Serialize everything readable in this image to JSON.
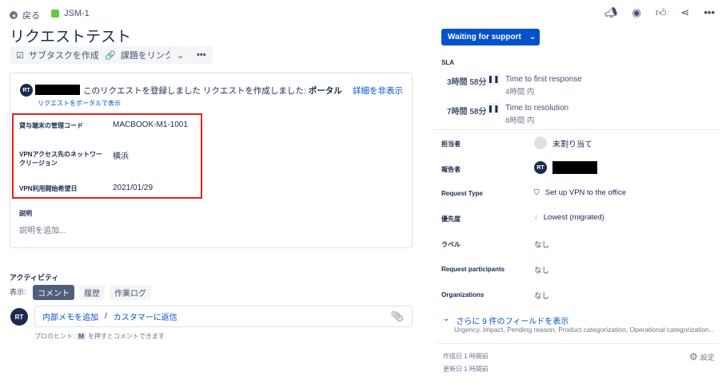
{
  "header": {
    "back": "戻る",
    "issue_key": "JSM-1",
    "title": "リクエストテスト"
  },
  "toolbar": {
    "subtask": "サブタスクを作成",
    "link_issue": "課題をリンク"
  },
  "request": {
    "avatar": "RT",
    "message": "このリクエストを登録しました リクエストを作成しました:",
    "channel": "ポータル",
    "hide_details": "詳細を非表示",
    "view_portal": "リクエストをポータルで表示"
  },
  "fields": [
    {
      "label": "貸与端末の管理コード",
      "value": "MACBOOK-M1-1001"
    },
    {
      "label": "VPNアクセス先のネットワークリージョン",
      "value": "横浜"
    },
    {
      "label": "VPN利用開始希望日",
      "value": "2021/01/29"
    }
  ],
  "description": {
    "label": "説明",
    "placeholder": "説明を追加..."
  },
  "activity": {
    "title": "アクティビティ",
    "show": "表示:",
    "tabs": [
      "コメント",
      "履歴",
      "作業ログ"
    ],
    "avatar": "RT",
    "internal_note": "内部メモを追加",
    "separator": "/",
    "reply": "カスタマーに返信",
    "hint_prefix": "プロのヒント:",
    "hint_key": "M",
    "hint_suffix": "を押すとコメントできます"
  },
  "status": {
    "label": "Waiting for support",
    "color": "#0052cc"
  },
  "sla": {
    "title": "SLA",
    "items": [
      {
        "remaining": "3時間 58分",
        "name": "Time to first response",
        "goal": "4時間 内"
      },
      {
        "remaining": "7時間 58分",
        "name": "Time to resolution",
        "goal": "8時間 内"
      }
    ]
  },
  "details": {
    "assignee_label": "担当者",
    "assignee": "未割り当て",
    "reporter_label": "報告者",
    "reporter_avatar": "RT",
    "request_type_label": "Request Type",
    "request_type": "Set up VPN to the office",
    "priority_label": "優先度",
    "priority": "Lowest (migrated)",
    "labels_label": "ラベル",
    "labels": "なし",
    "participants_label": "Request participants",
    "participants": "なし",
    "orgs_label": "Organizations",
    "orgs": "なし"
  },
  "more_fields": {
    "label": "さらに 9 件のフィールドを表示",
    "list": "Urgency, Impact, Pending reason, Product categorization, Operational categorization..."
  },
  "footer": {
    "created": "作成日 1 時間前",
    "updated": "更新日 1 時間前",
    "settings": "設定"
  }
}
